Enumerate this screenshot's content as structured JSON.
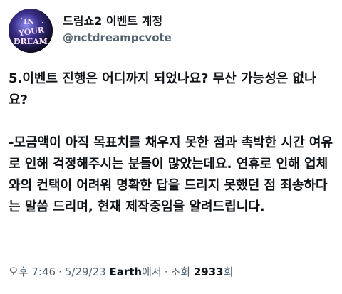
{
  "tweet": {
    "author": {
      "display_name": "드림쇼2 이벤트 계정",
      "handle": "@nctdreampcvote",
      "avatar_text": [
        "IN",
        "YOUR",
        "DREAM"
      ],
      "avatar_icon": "in-your-dream-logo"
    },
    "body": {
      "question": "5.이벤트 진행은 어디까지 되었나요? 무산 가능성은 없나요?",
      "answer": "-모금액이 아직 목표치를 채우지 못한 점과 촉박한 시간 여유로 인해 걱정해주시는 분들이 많았는데요. 연휴로 인해 업체와의 컨택이 어려워 명확한 답을 드리지 못했던 점 죄송하다는 말씀 드리며, 현재 제작중임을 알려드립니다."
    },
    "meta": {
      "time": "오후 7:46",
      "date": "5/29/23",
      "source_name": "Earth",
      "source_suffix": "에서",
      "views_label": "조회",
      "views_count": "2933",
      "views_suffix": "회"
    }
  },
  "colors": {
    "text_primary": "#0f1419",
    "text_secondary": "#536471",
    "background": "#ffffff"
  }
}
